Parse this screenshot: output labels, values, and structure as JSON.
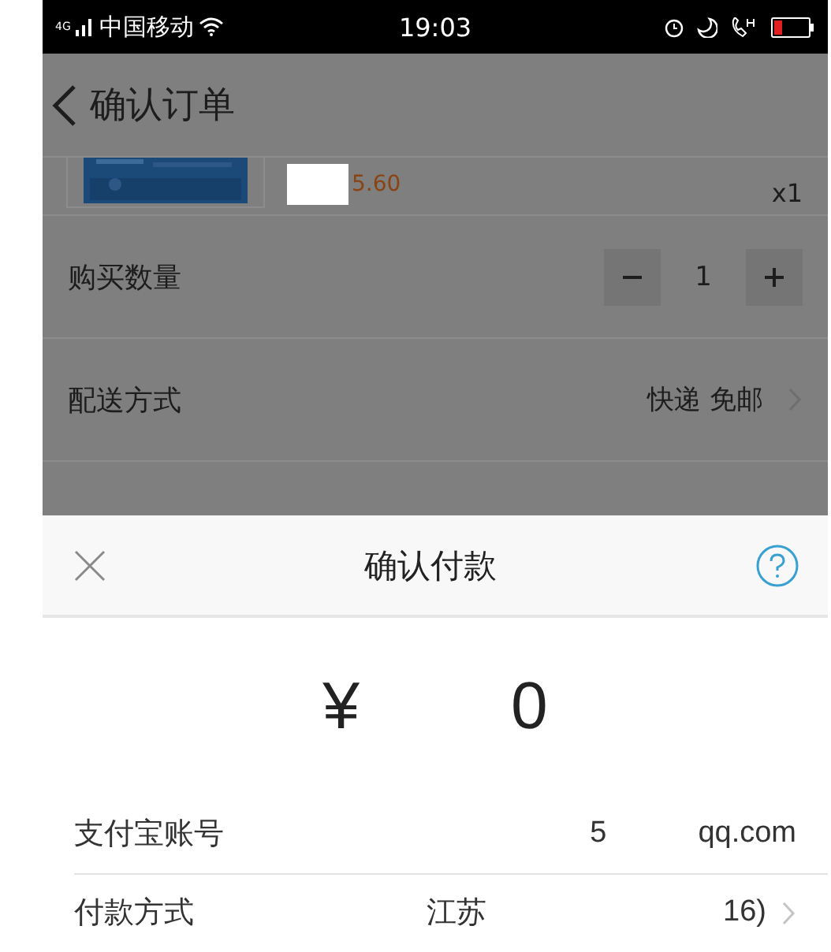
{
  "status_bar": {
    "network": "4G",
    "carrier": "中国移动",
    "time": "19:03"
  },
  "nav": {
    "title": "确认订单"
  },
  "product": {
    "price": "5.60",
    "quantity": "x1"
  },
  "rows": [
    {
      "kind": "stepper",
      "label": "购买数量",
      "value": "1"
    },
    {
      "kind": "link",
      "label": "配送方式",
      "value": "快递 免邮"
    }
  ],
  "sheet": {
    "title": "确认付款",
    "amount_prefix": "¥",
    "amount_suffix": "0",
    "rows": [
      {
        "label": "支付宝账号",
        "value_start": "5",
        "value_end": "qq.com",
        "chevron": false
      },
      {
        "label": "付款方式",
        "value_start": "江苏",
        "value_end": "16)",
        "chevron": true
      }
    ]
  }
}
